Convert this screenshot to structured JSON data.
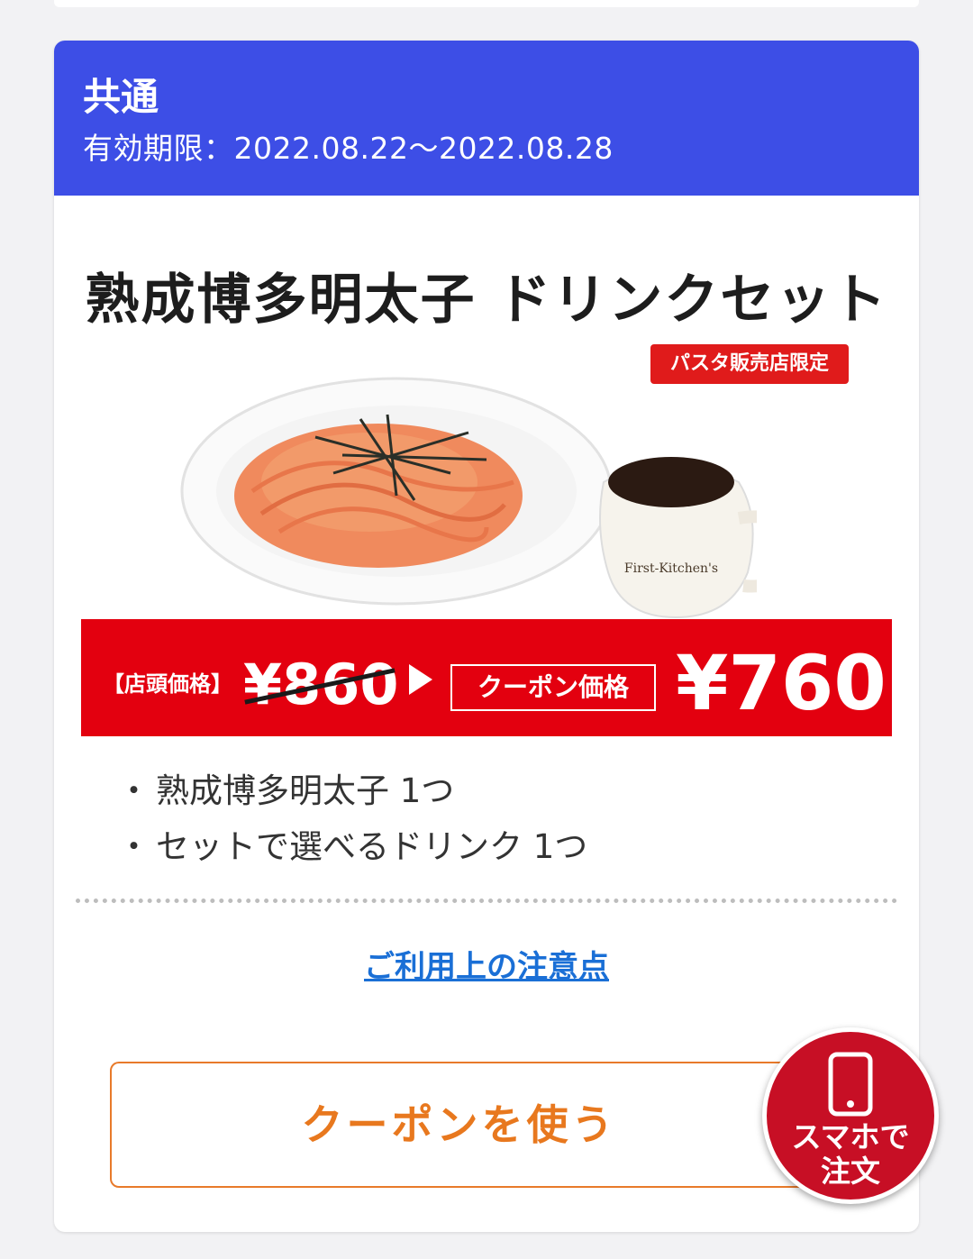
{
  "coupon": {
    "category": "共通",
    "validity": "有効期限：2022.08.22〜2022.08.28",
    "product_title": "熟成博多明太子 ドリンクセット",
    "limited_badge": "パスタ販売店限定",
    "price": {
      "store_label": "【店頭価格】",
      "old_price": "¥860",
      "coupon_label": "クーポン価格",
      "new_price": "¥760"
    },
    "items": [
      "熟成博多明太子 1つ",
      "セットで選べるドリンク 1つ"
    ],
    "notice_link": "ご利用上の注意点",
    "use_button": "クーポンを使う"
  },
  "floating_button": {
    "icon": "smartphone-icon",
    "label_line1": "スマホで",
    "label_line2": "注文"
  },
  "colors": {
    "header": "#3d4ee6",
    "price_band": "#e3000f",
    "accent_orange": "#e8781e",
    "floating": "#c70f25",
    "link": "#1a6fd6"
  }
}
